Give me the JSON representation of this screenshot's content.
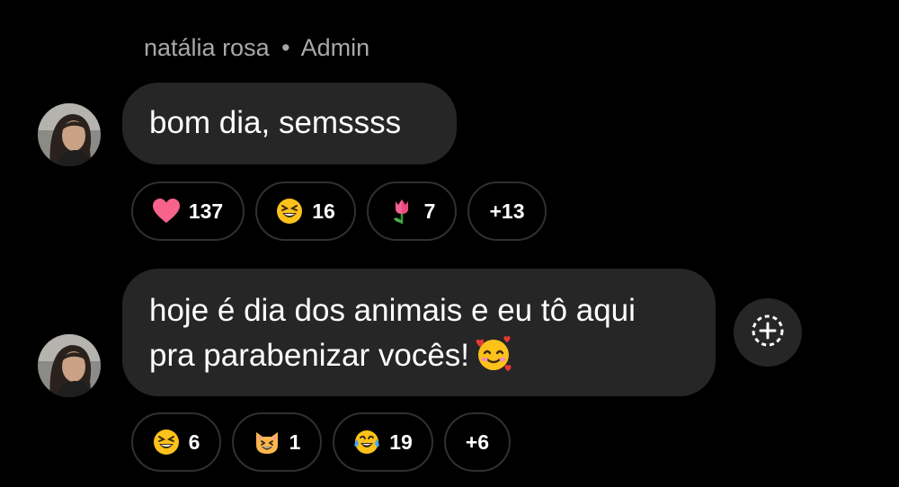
{
  "header": {
    "sender_name": "natália rosa",
    "separator": "•",
    "role": "Admin"
  },
  "messages": [
    {
      "text": "bom dia, semssss",
      "reactions": [
        {
          "emoji": "heart-emoji",
          "count": "137"
        },
        {
          "emoji": "grinning-squinting-emoji",
          "count": "16"
        },
        {
          "emoji": "tulip-emoji",
          "count": "7"
        },
        {
          "emoji": "",
          "count": "+13"
        }
      ]
    },
    {
      "lines": [
        "hoje é dia dos animais e eu tô aqui",
        "pra parabenizar vocês!"
      ],
      "trailing_emoji": "smiling-face-with-hearts-emoji",
      "reactions": [
        {
          "emoji": "grinning-squinting-emoji",
          "count": "6"
        },
        {
          "emoji": "grinning-cat-emoji",
          "count": "1"
        },
        {
          "emoji": "tears-of-joy-emoji",
          "count": "19"
        },
        {
          "emoji": "",
          "count": "+6"
        }
      ]
    }
  ],
  "actions": {
    "add_reaction_icon": "add-reaction-icon"
  },
  "colors": {
    "background": "#000000",
    "bubble": "#262626",
    "pill_border": "#303030",
    "muted_text": "#a8a8a8"
  }
}
